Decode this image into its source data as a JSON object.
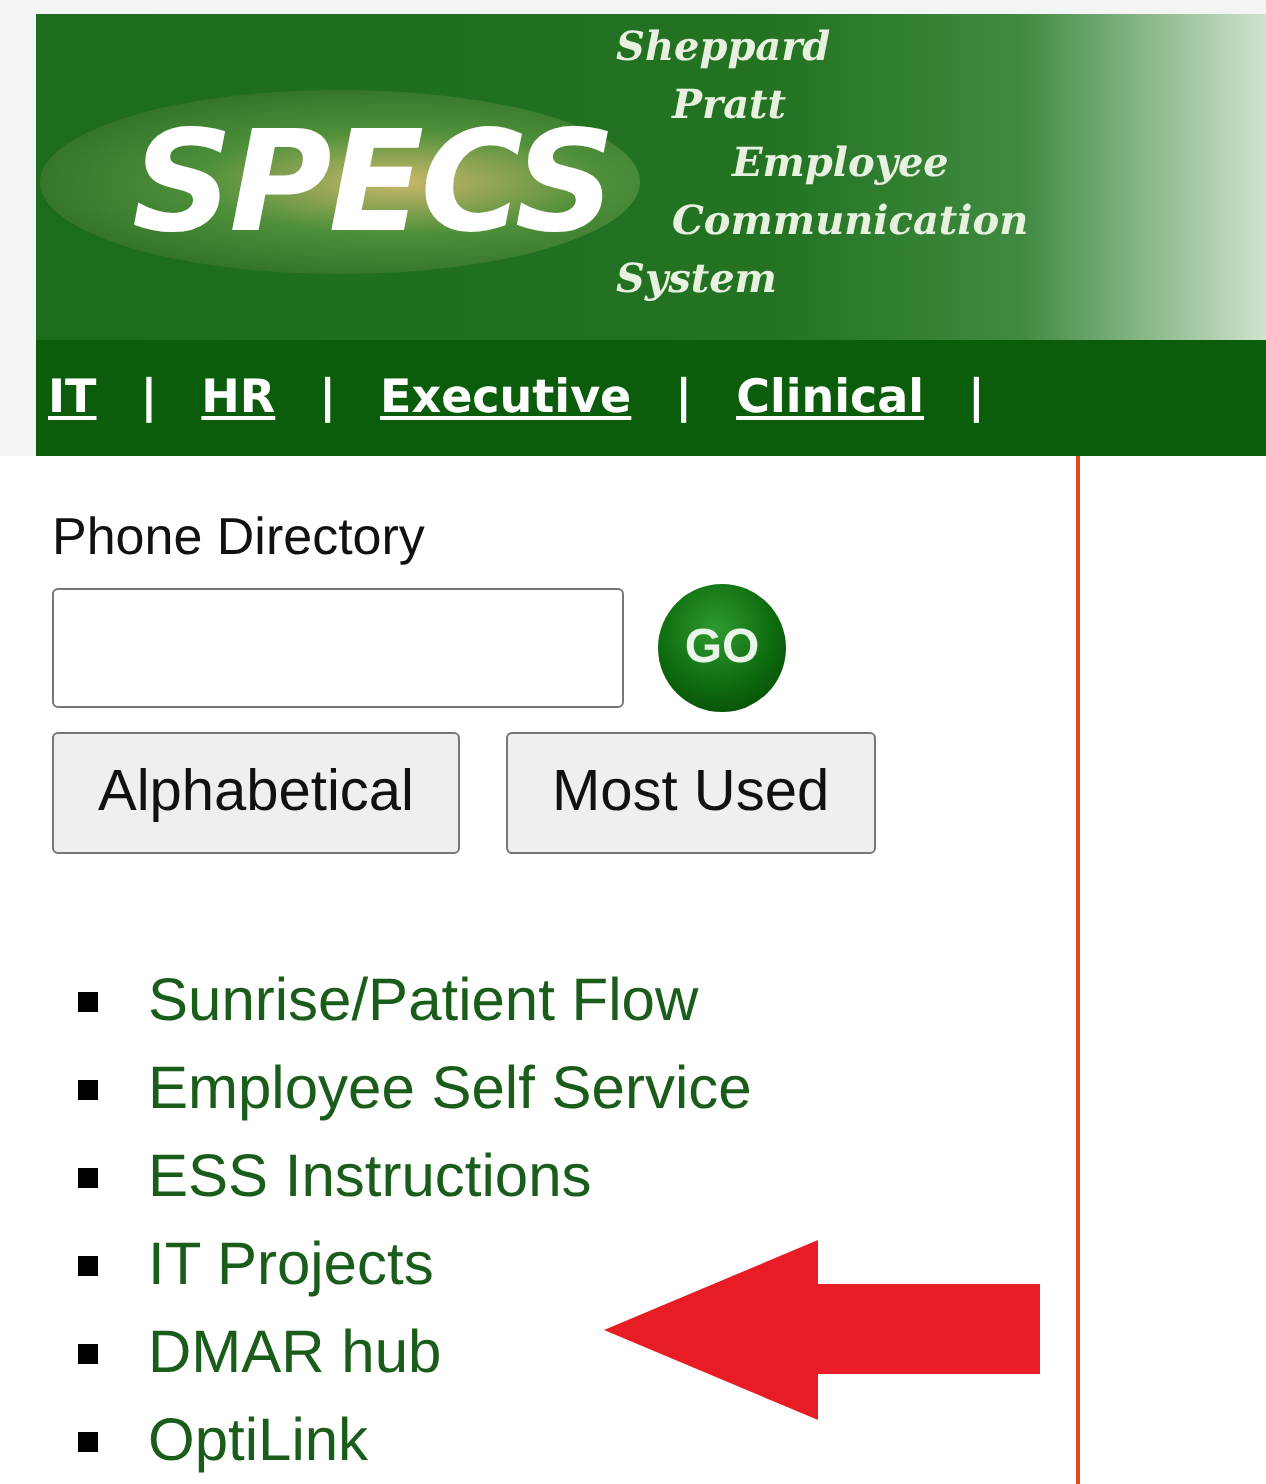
{
  "banner": {
    "logo": "SPECS",
    "tagline": [
      "Sheppard",
      "Pratt",
      "Employee",
      "Communication",
      "System"
    ]
  },
  "nav": {
    "links": [
      "IT",
      "HR",
      "Executive",
      "Clinical"
    ],
    "separator": "|"
  },
  "phone_directory": {
    "label": "Phone Directory",
    "go_button": "GO",
    "buttons": [
      "Alphabetical",
      "Most Used"
    ]
  },
  "links": [
    "Sunrise/Patient Flow",
    "Employee Self Service",
    "ESS Instructions",
    "IT Projects",
    "DMAR hub",
    "OptiLink"
  ]
}
